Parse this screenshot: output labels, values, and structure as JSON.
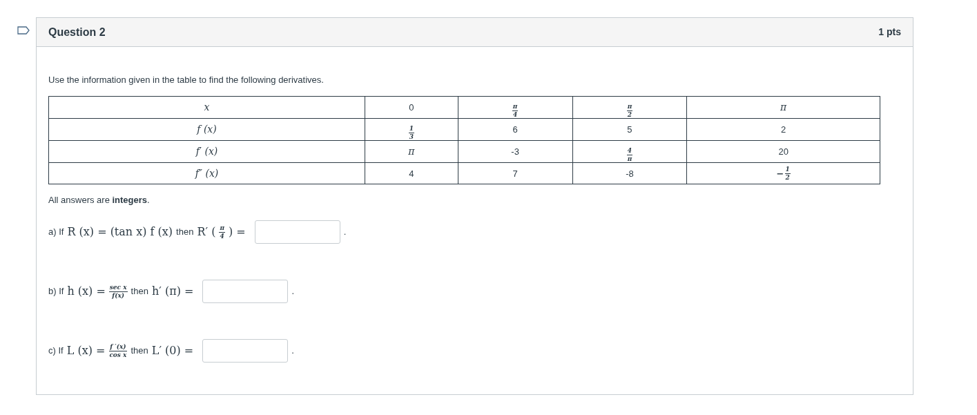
{
  "question": {
    "title": "Question 2",
    "points": "1 pts"
  },
  "intro": "Use the information given in the table to find the following derivatives.",
  "table": {
    "rows": [
      [
        {
          "kind": "math",
          "text": "x"
        },
        {
          "kind": "text",
          "text": "0"
        },
        {
          "kind": "frac",
          "num": "π",
          "den": "4"
        },
        {
          "kind": "frac",
          "num": "π",
          "den": "2"
        },
        {
          "kind": "math",
          "text": "π"
        }
      ],
      [
        {
          "kind": "math",
          "text": "f (x)"
        },
        {
          "kind": "frac",
          "num": "1",
          "den": "3"
        },
        {
          "kind": "text",
          "text": "6"
        },
        {
          "kind": "text",
          "text": "5"
        },
        {
          "kind": "text",
          "text": "2"
        }
      ],
      [
        {
          "kind": "math",
          "text": "f′ (x)"
        },
        {
          "kind": "math",
          "text": "π"
        },
        {
          "kind": "text",
          "text": "-3"
        },
        {
          "kind": "frac",
          "num": "4",
          "den": "π"
        },
        {
          "kind": "text",
          "text": "20"
        }
      ],
      [
        {
          "kind": "math",
          "text": "f″ (x)"
        },
        {
          "kind": "text",
          "text": "4"
        },
        {
          "kind": "text",
          "text": "7"
        },
        {
          "kind": "text",
          "text": "-8"
        },
        {
          "kind": "frac",
          "sign": "−",
          "num": "1",
          "den": "2"
        }
      ]
    ]
  },
  "note": "All answers are **integers**.",
  "parts": [
    {
      "items": [
        {
          "kind": "text",
          "text": "a) If"
        },
        {
          "kind": "math",
          "text": "R (x) = (tan x) f (x)"
        },
        {
          "kind": "text",
          "text": "then"
        },
        {
          "kind": "math",
          "text": "R′ ("
        },
        {
          "kind": "frac",
          "num": "π",
          "den": "4"
        },
        {
          "kind": "math",
          "text": ") ="
        },
        {
          "kind": "field"
        },
        {
          "kind": "text",
          "text": "."
        }
      ]
    },
    {
      "items": [
        {
          "kind": "text",
          "text": "b) If"
        },
        {
          "kind": "math",
          "text": "h (x) ="
        },
        {
          "kind": "frac",
          "num": "sec x",
          "den": "f(x)"
        },
        {
          "kind": "text",
          "text": "then"
        },
        {
          "kind": "math",
          "text": "h′ (π) ="
        },
        {
          "kind": "field"
        },
        {
          "kind": "text",
          "text": "."
        }
      ]
    },
    {
      "items": [
        {
          "kind": "text",
          "text": "c) If"
        },
        {
          "kind": "math",
          "text": "L (x) ="
        },
        {
          "kind": "frac",
          "num": "f ′(x)",
          "den": "cos x"
        },
        {
          "kind": "text",
          "text": "then"
        },
        {
          "kind": "math",
          "text": "L′ (0) ="
        },
        {
          "kind": "field"
        },
        {
          "kind": "text",
          "text": "."
        }
      ]
    }
  ]
}
